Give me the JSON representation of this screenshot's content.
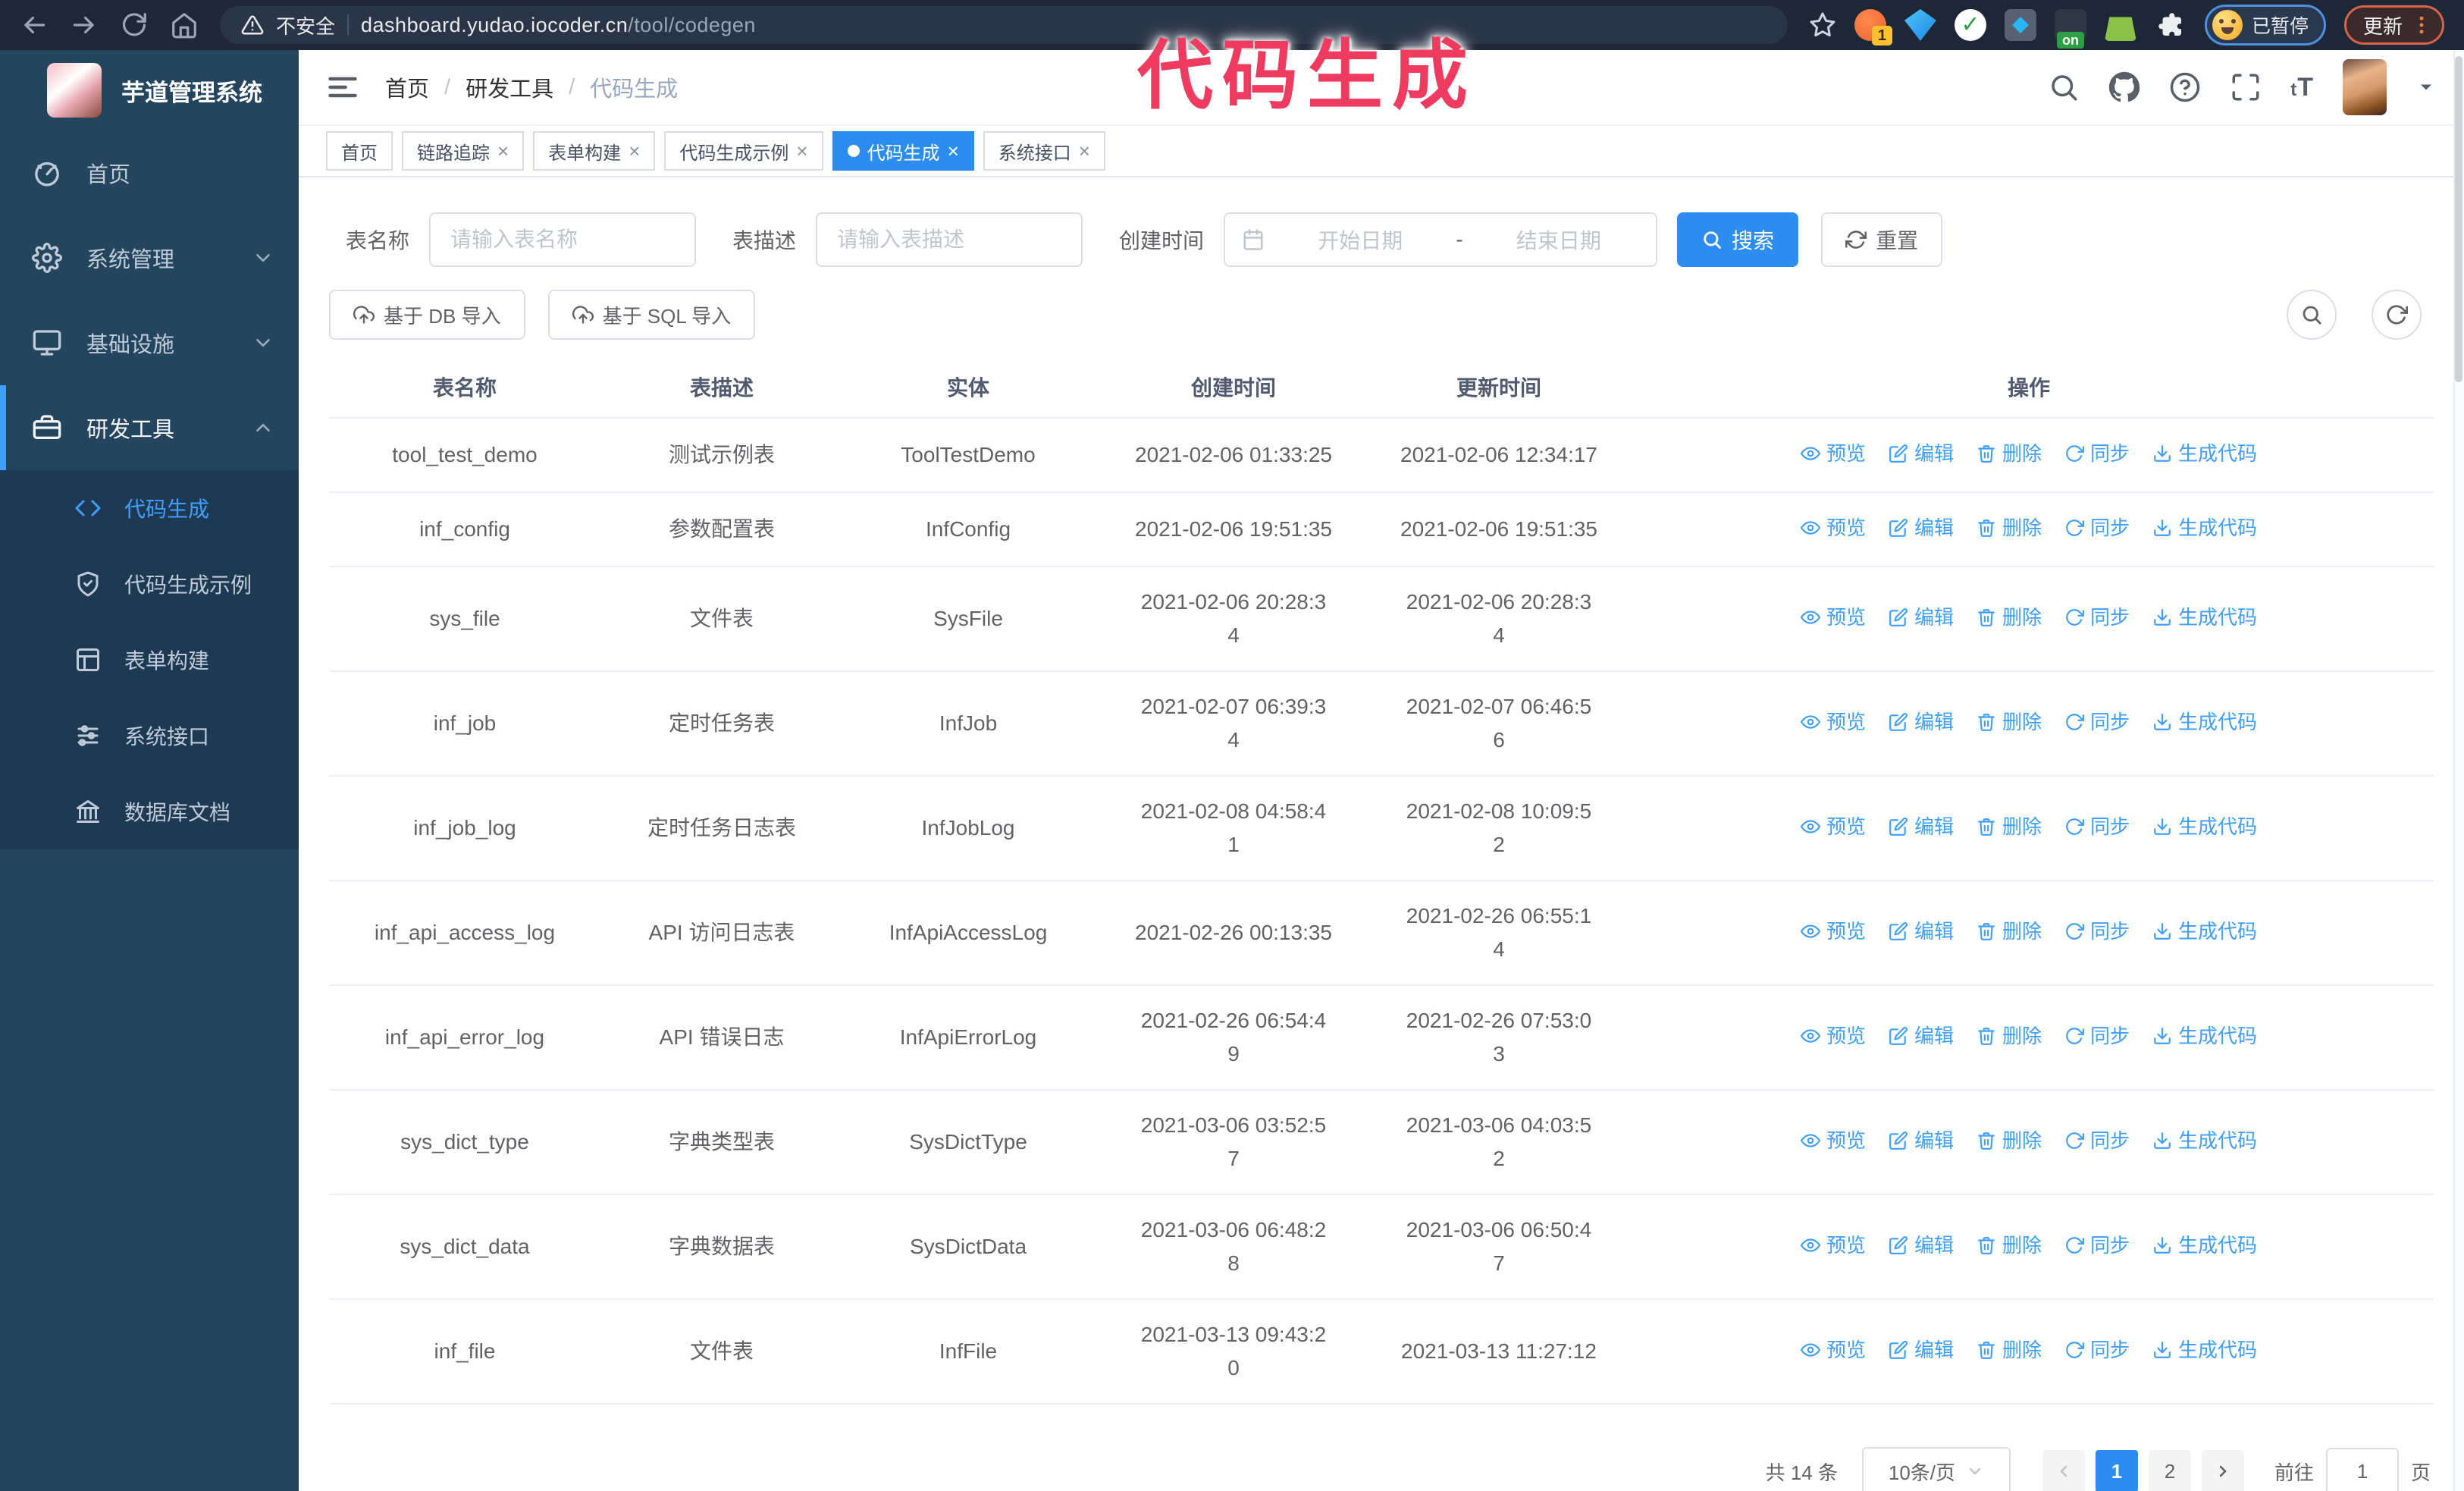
{
  "browser": {
    "warning_text": "不安全",
    "url_host": "dashboard.yudao.iocoder.cn",
    "url_path": "/tool/codegen",
    "ext_badge_count": "1",
    "ext_on_label": "on",
    "profile_badge": "已暂停",
    "update_button": "更新"
  },
  "overlay_annotation": {
    "text": "代码生成",
    "color": "#ee3b5f"
  },
  "sidebar": {
    "logo_title": "芋道管理系统",
    "items": [
      {
        "label": "首页",
        "icon": "dashboard-icon",
        "expandable": false,
        "expanded": false,
        "active": false
      },
      {
        "label": "系统管理",
        "icon": "gear-icon",
        "expandable": true,
        "expanded": false,
        "active": false
      },
      {
        "label": "基础设施",
        "icon": "monitor-icon",
        "expandable": true,
        "expanded": false,
        "active": false
      },
      {
        "label": "研发工具",
        "icon": "toolbox-icon",
        "expandable": true,
        "expanded": true,
        "active": true
      }
    ],
    "subitems": [
      {
        "label": "代码生成",
        "icon": "code-icon",
        "active": true
      },
      {
        "label": "代码生成示例",
        "icon": "shield-check-icon",
        "active": false
      },
      {
        "label": "表单构建",
        "icon": "form-icon",
        "active": false
      },
      {
        "label": "系统接口",
        "icon": "sliders-icon",
        "active": false
      },
      {
        "label": "数据库文档",
        "icon": "database-icon",
        "active": false
      }
    ]
  },
  "navbar": {
    "breadcrumb": [
      "首页",
      "研发工具",
      "代码生成"
    ]
  },
  "tags_view": [
    {
      "label": "首页",
      "active": false,
      "closable": false
    },
    {
      "label": "链路追踪",
      "active": false,
      "closable": true
    },
    {
      "label": "表单构建",
      "active": false,
      "closable": true
    },
    {
      "label": "代码生成示例",
      "active": false,
      "closable": true
    },
    {
      "label": "代码生成",
      "active": true,
      "closable": true
    },
    {
      "label": "系统接口",
      "active": false,
      "closable": true
    }
  ],
  "filters": {
    "table_name_label": "表名称",
    "table_name_placeholder": "请输入表名称",
    "table_desc_label": "表描述",
    "table_desc_placeholder": "请输入表描述",
    "create_time_label": "创建时间",
    "date_start_placeholder": "开始日期",
    "date_separator": "-",
    "date_end_placeholder": "结束日期",
    "search_button": "搜索",
    "reset_button": "重置"
  },
  "toolbar": {
    "import_db_button": "基于 DB 导入",
    "import_sql_button": "基于 SQL 导入"
  },
  "table": {
    "columns": [
      "表名称",
      "表描述",
      "实体",
      "创建时间",
      "更新时间",
      "操作"
    ],
    "row_actions": [
      {
        "label": "预览",
        "icon": "eye-icon"
      },
      {
        "label": "编辑",
        "icon": "edit-icon"
      },
      {
        "label": "删除",
        "icon": "delete-icon"
      },
      {
        "label": "同步",
        "icon": "sync-icon"
      },
      {
        "label": "生成代码",
        "icon": "generate-icon"
      }
    ],
    "rows": [
      {
        "name": "tool_test_demo",
        "description": "测试示例表",
        "entity": "ToolTestDemo",
        "created": "2021-02-06 01:33:25",
        "updated": "2021-02-06 12:34:17"
      },
      {
        "name": "inf_config",
        "description": "参数配置表",
        "entity": "InfConfig",
        "created": "2021-02-06 19:51:35",
        "updated": "2021-02-06 19:51:35"
      },
      {
        "name": "sys_file",
        "description": "文件表",
        "entity": "SysFile",
        "created": "2021-02-06 20:28:3\n4",
        "updated": "2021-02-06 20:28:3\n4"
      },
      {
        "name": "inf_job",
        "description": "定时任务表",
        "entity": "InfJob",
        "created": "2021-02-07 06:39:3\n4",
        "updated": "2021-02-07 06:46:5\n6"
      },
      {
        "name": "inf_job_log",
        "description": "定时任务日志表",
        "entity": "InfJobLog",
        "created": "2021-02-08 04:58:4\n1",
        "updated": "2021-02-08 10:09:5\n2"
      },
      {
        "name": "inf_api_access_log",
        "description": "API 访问日志表",
        "entity": "InfApiAccessLog",
        "created": "2021-02-26 00:13:35",
        "updated": "2021-02-26 06:55:1\n4"
      },
      {
        "name": "inf_api_error_log",
        "description": "API 错误日志",
        "entity": "InfApiErrorLog",
        "created": "2021-02-26 06:54:4\n9",
        "updated": "2021-02-26 07:53:0\n3"
      },
      {
        "name": "sys_dict_type",
        "description": "字典类型表",
        "entity": "SysDictType",
        "created": "2021-03-06 03:52:5\n7",
        "updated": "2021-03-06 04:03:5\n2"
      },
      {
        "name": "sys_dict_data",
        "description": "字典数据表",
        "entity": "SysDictData",
        "created": "2021-03-06 06:48:2\n8",
        "updated": "2021-03-06 06:50:4\n7"
      },
      {
        "name": "inf_file",
        "description": "文件表",
        "entity": "InfFile",
        "created": "2021-03-13 09:43:2\n0",
        "updated": "2021-03-13 11:27:12"
      }
    ]
  },
  "pagination": {
    "total": "共 14 条",
    "page_size": "10条/页",
    "pages": [
      "1",
      "2"
    ],
    "current": "1",
    "goto_label": "前往",
    "goto_value": "1",
    "page_unit": "页"
  },
  "colors": {
    "accent": "#2d8cf0",
    "link": "#409eff",
    "sidebar_bg": "#24455e",
    "submenu_bg": "#1d3a52",
    "annotation": "#ee3b5f",
    "browser_bar": "#1d2735"
  }
}
